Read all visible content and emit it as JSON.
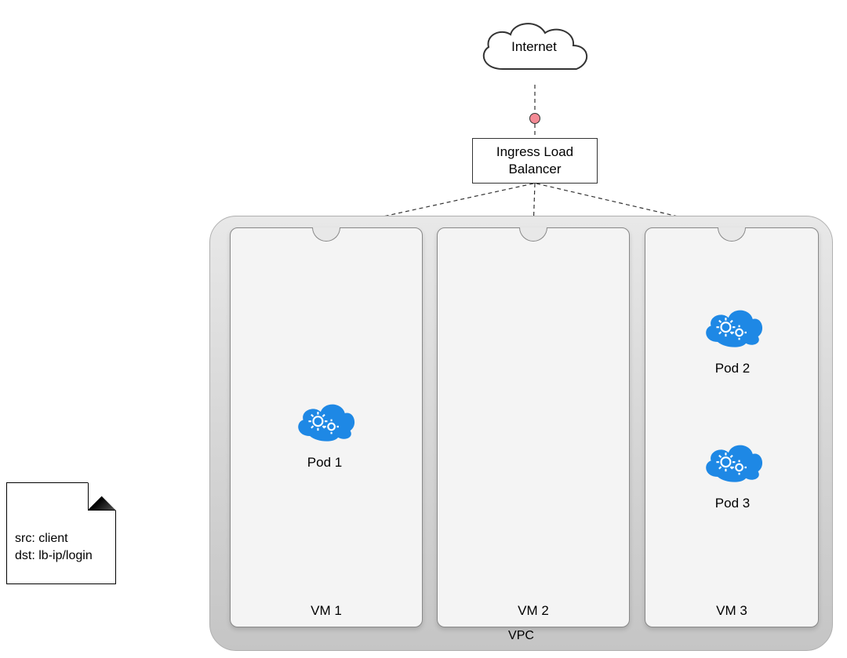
{
  "internet": {
    "label": "Internet"
  },
  "loadBalancer": {
    "label": "Ingress Load\nBalancer"
  },
  "vpc": {
    "label": "VPC"
  },
  "vms": {
    "vm1": "VM 1",
    "vm2": "VM 2",
    "vm3": "VM 3"
  },
  "pods": {
    "pod1": "Pod 1",
    "pod2": "Pod 2",
    "pod3": "Pod 3"
  },
  "note": {
    "line1": "src: client",
    "line2": "dst: lb-ip/login"
  },
  "colors": {
    "podBlue": "#1e88e5",
    "pinkDot": "#f48a95"
  }
}
